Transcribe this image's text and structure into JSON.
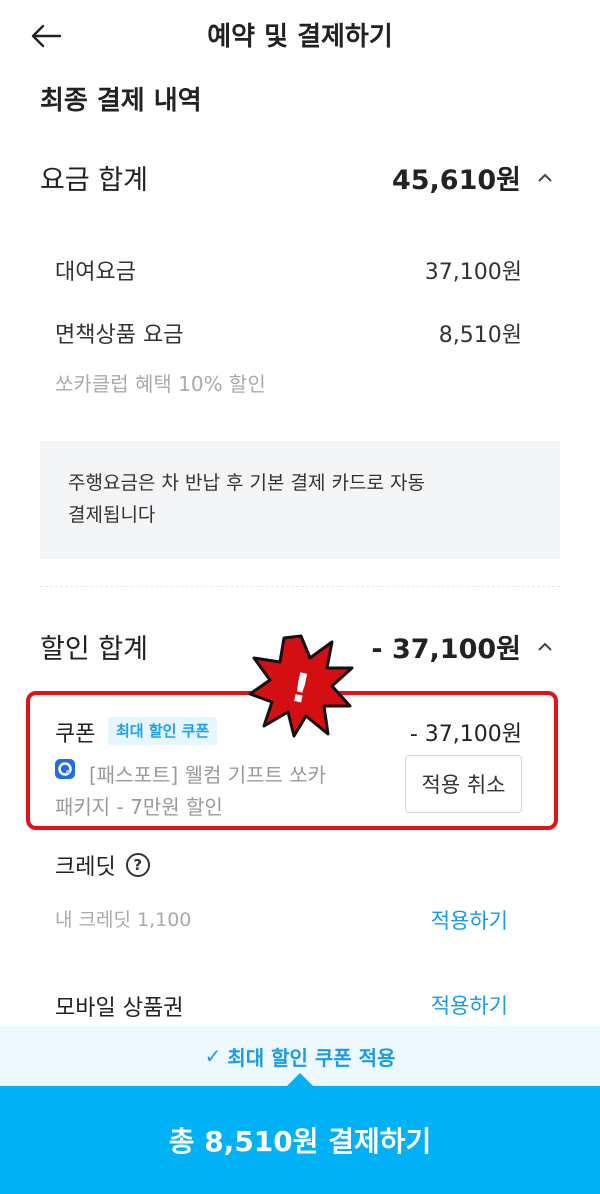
{
  "header": {
    "title": "예약 및 결제하기"
  },
  "section_title": "최종 결제 내역",
  "fee": {
    "label": "요금 합계",
    "amount": "45,610원",
    "items": [
      {
        "label": "대여요금",
        "amount": "37,100원"
      },
      {
        "label": "면책상품 요금",
        "amount": "8,510원"
      }
    ],
    "note": "쏘카클럽 혜택 10% 할인"
  },
  "info_box": {
    "line1": "주행요금은 차 반납 후 기본 결제 카드로 자동",
    "line2": "결제됩니다"
  },
  "discount": {
    "label": "할인 합계",
    "amount": "- 37,100원",
    "coupon": {
      "label": "쿠폰",
      "badge": "최대 할인 쿠폰",
      "amount": "- 37,100원",
      "desc_line1": "[패스포트] 웰컴 기프트 쏘카",
      "desc_line2": "패키지 - 7만원 할인",
      "cancel_label": "적용 취소"
    },
    "credit": {
      "label": "크레딧",
      "help_glyph": "?",
      "sub": "내 크레딧 1,100",
      "apply_label": "적용하기"
    },
    "giftcard": {
      "label": "모바일 상품권",
      "apply_label": "적용하기"
    }
  },
  "banner": {
    "check": "✓",
    "text": "최대 할인 쿠폰 적용"
  },
  "pay_button": {
    "label": "총 8,510원 결제하기"
  },
  "alert_icon": {
    "glyph": "!",
    "color": "#e80f16"
  },
  "colors": {
    "accent": "#00b2f5",
    "link": "#1a9be6",
    "highlight_border": "#e80f16",
    "badge_bg": "#e6f6ff"
  }
}
